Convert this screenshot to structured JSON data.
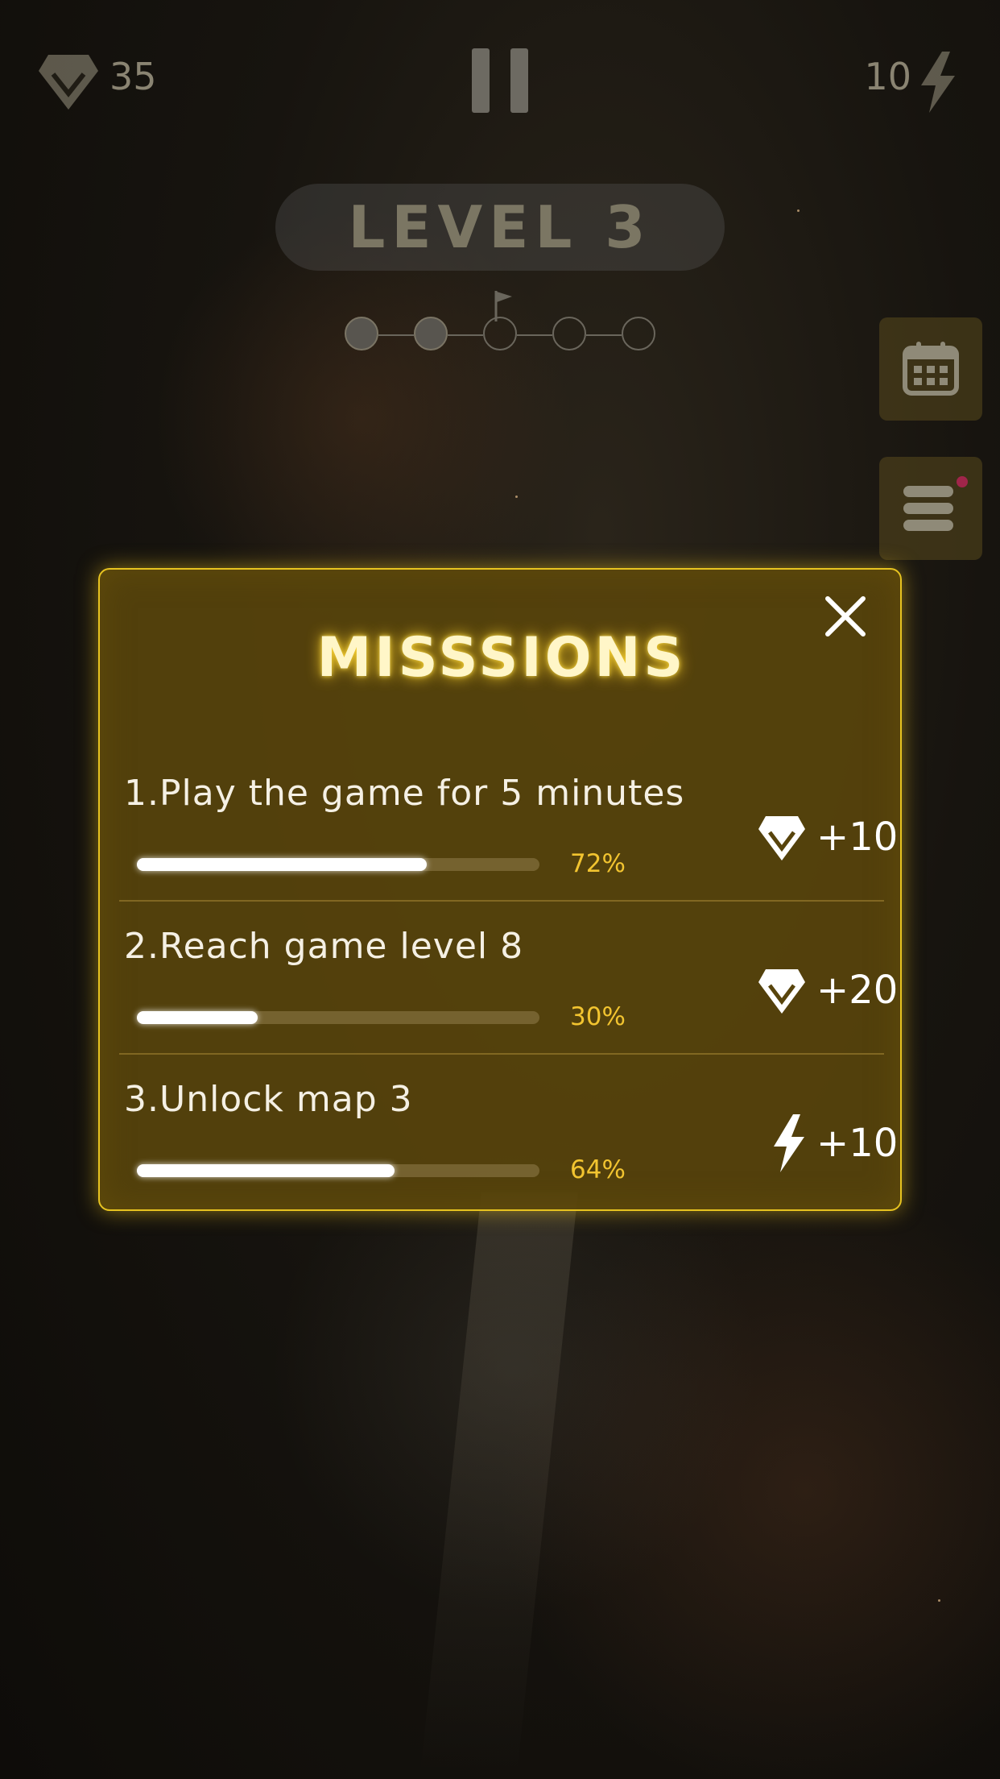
{
  "hud": {
    "gems": "35",
    "energy": "10"
  },
  "level": {
    "title": "LEVEL 3",
    "stages_total": 5,
    "stages_done": 2,
    "flag_stage": 3
  },
  "side_buttons": [
    "calendar-icon",
    "missions-list-icon"
  ],
  "modal": {
    "title": "MISSSIONS",
    "missions": [
      {
        "number": "1.",
        "text": "Play the game for 5 minutes",
        "progress": 0.72,
        "percent": "72%",
        "reward_icon": "gem-icon",
        "reward": "+10"
      },
      {
        "number": "2.",
        "text": "Reach game level 8",
        "progress": 0.3,
        "percent": "30%",
        "reward_icon": "gem-icon",
        "reward": "+20"
      },
      {
        "number": "3.",
        "text": "Unlock map 3",
        "progress": 0.64,
        "percent": "64%",
        "reward_icon": "lightning-icon",
        "reward": "+10"
      }
    ]
  },
  "colors": {
    "accent": "#e7c320",
    "percent_text": "#f2c430",
    "modal_bg": "#58440c"
  }
}
